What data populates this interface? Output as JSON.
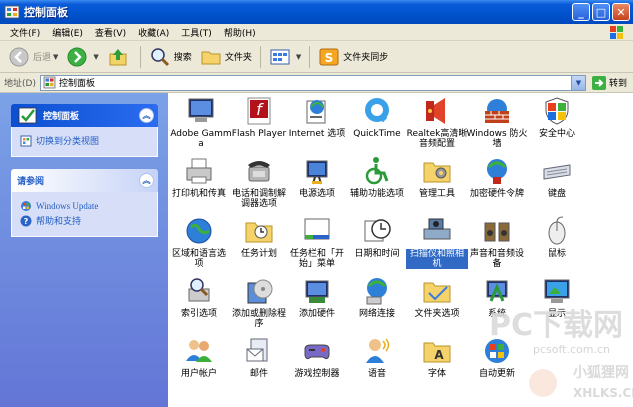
{
  "window": {
    "title": "控制面板"
  },
  "menu": [
    "文件(F)",
    "编辑(E)",
    "查看(V)",
    "收藏(A)",
    "工具(T)",
    "帮助(H)"
  ],
  "toolbar": {
    "back": "后退",
    "search": "搜索",
    "folders": "文件夹",
    "folder_sync": "文件夹同步"
  },
  "address": {
    "label": "地址(D)",
    "value": "控制面板",
    "go": "转到"
  },
  "left_panel": {
    "cp_title": "控制面板",
    "switch_view": "切换到分类视图",
    "see_also_title": "请参阅",
    "see_also": [
      "Windows Update",
      "帮助和支持"
    ]
  },
  "items": [
    "Adobe Gamma",
    "Flash Player",
    "Internet 选项",
    "QuickTime",
    "Realtek高清晰音频配置",
    "Windows 防火墙",
    "安全中心",
    "打印机和传真",
    "电话和调制解调器选项",
    "电源选项",
    "辅助功能选项",
    "管理工具",
    "加密硬件令牌",
    "键盘",
    "区域和语言选项",
    "任务计划",
    "任务栏和「开始」菜单",
    "日期和时间",
    "扫描仪和照相机",
    "声音和音频设备",
    "鼠标",
    "索引选项",
    "添加或删除程序",
    "添加硬件",
    "网络连接",
    "文件夹选项",
    "系统",
    "显示",
    "用户帐户",
    "邮件",
    "游戏控制器",
    "语音",
    "字体",
    "自动更新"
  ],
  "selected_item": "扫描仪和照相机",
  "watermark": {
    "line1": "PC下载网",
    "line2": "pcsoft.com.cn",
    "line3": "小狐狸网",
    "line4": "XHLKS.CN"
  }
}
